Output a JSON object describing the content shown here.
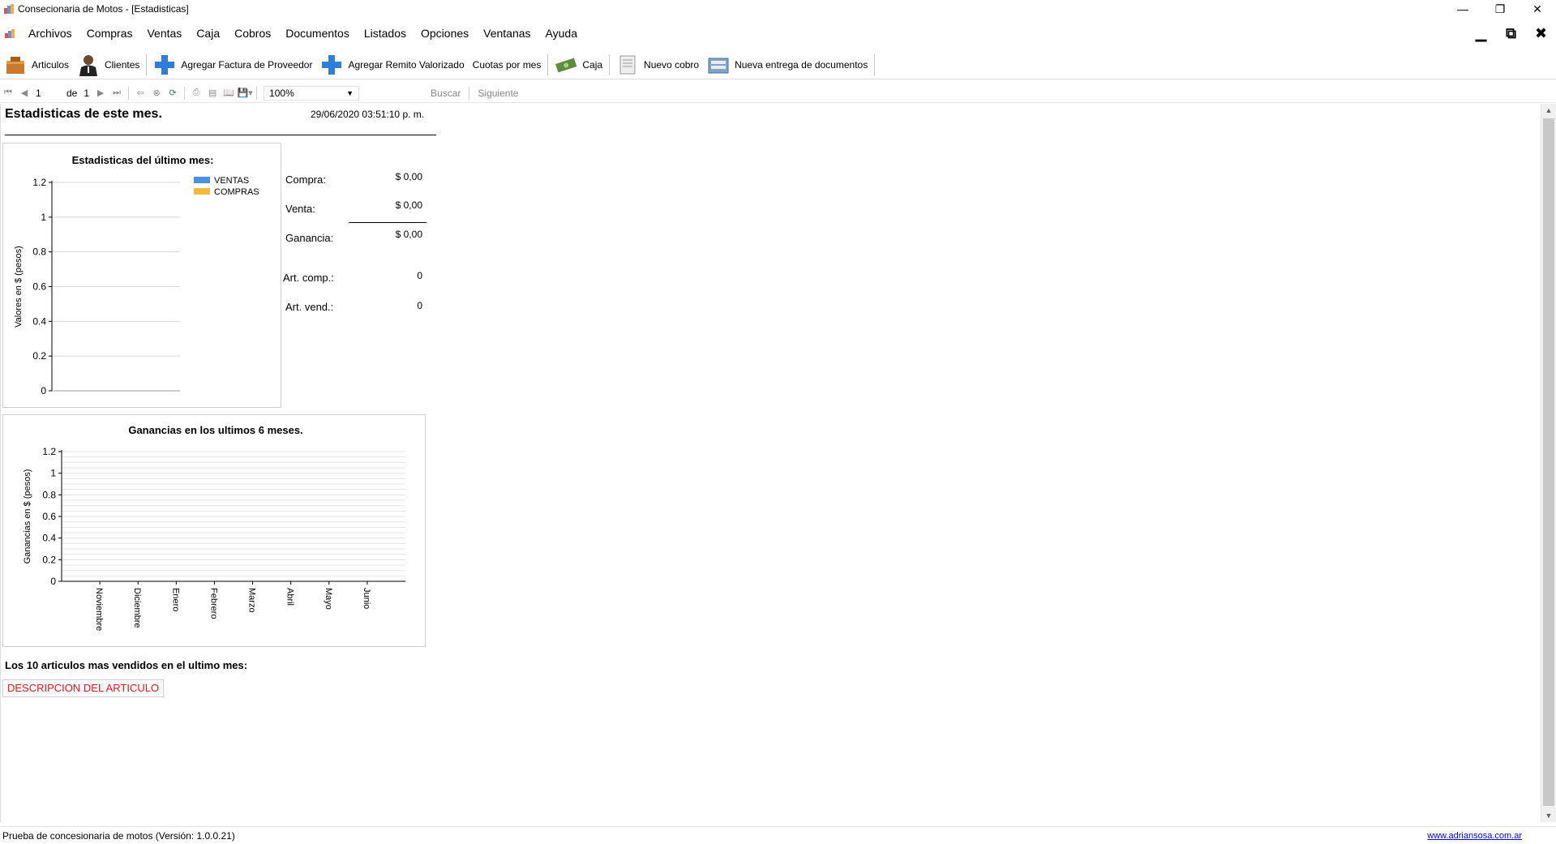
{
  "window": {
    "title": "Consecionaria de Motos - [Estadisticas]"
  },
  "menu": {
    "items": [
      "Archivos",
      "Compras",
      "Ventas",
      "Caja",
      "Cobros",
      "Documentos",
      "Listados",
      "Opciones",
      "Ventanas",
      "Ayuda"
    ]
  },
  "toolbar": {
    "articulos": "Articulos",
    "clientes": "Clientes",
    "agregar_factura": "Agregar Factura de Proveedor",
    "agregar_remito": "Agregar Remito Valorizado",
    "cuotas": "Cuotas por mes",
    "caja": "Caja",
    "nuevo_cobro": "Nuevo cobro",
    "nueva_entrega": "Nueva entrega de documentos"
  },
  "viewer": {
    "page_current": "1",
    "page_of": "de",
    "page_total": "1",
    "zoom": "100%",
    "find": "Buscar",
    "next": "Siguiente"
  },
  "report": {
    "title": "Estadisticas de este mes.",
    "datetime": "29/06/2020 03:51:10 p. m.",
    "stats": {
      "compra_label": "Compra:",
      "compra_value": "$ 0,00",
      "venta_label": "Venta:",
      "venta_value": "$ 0,00",
      "ganancia_label": "Ganancia:",
      "ganancia_value": "$ 0,00",
      "art_comp_label": "Art. comp.:",
      "art_comp_value": "0",
      "art_vend_label": "Art. vend.:",
      "art_vend_value": "0"
    },
    "top10_title": "Los 10 articulos mas vendidos en el ultimo mes:",
    "top10_header": "DESCRIPCION DEL ARTICULO"
  },
  "chart_data": [
    {
      "type": "bar",
      "title": "Estadisticas del último mes:",
      "xlabel": "",
      "ylabel": "Valores en $ (pesos)",
      "ylim": [
        0,
        1.2
      ],
      "yticks": [
        "0",
        "0.2",
        "0.4",
        "0.6",
        "0.8",
        "1",
        "1.2"
      ],
      "categories": [],
      "series": [
        {
          "name": "VENTAS",
          "color": "#4a90e2",
          "values": []
        },
        {
          "name": "COMPRAS",
          "color": "#f5b942",
          "values": []
        }
      ],
      "legend": "top-right"
    },
    {
      "type": "line",
      "title": "Ganancias en los ultimos 6 meses.",
      "xlabel": "",
      "ylabel": "Ganancias en $ (pesos)",
      "ylim": [
        0,
        1.2
      ],
      "yticks": [
        "0",
        "0.2",
        "0.4",
        "0.6",
        "0.8",
        "1",
        "1.2"
      ],
      "categories": [
        "Noviembre",
        "Diciembre",
        "Enero",
        "Febrero",
        "Marzo",
        "Abril",
        "Mayo",
        "Junio"
      ],
      "series": []
    }
  ],
  "status": {
    "left": "Prueba de concesionaria de motos  (Versión: 1.0.0.21)",
    "right": "www.adriansosa.com.ar"
  }
}
